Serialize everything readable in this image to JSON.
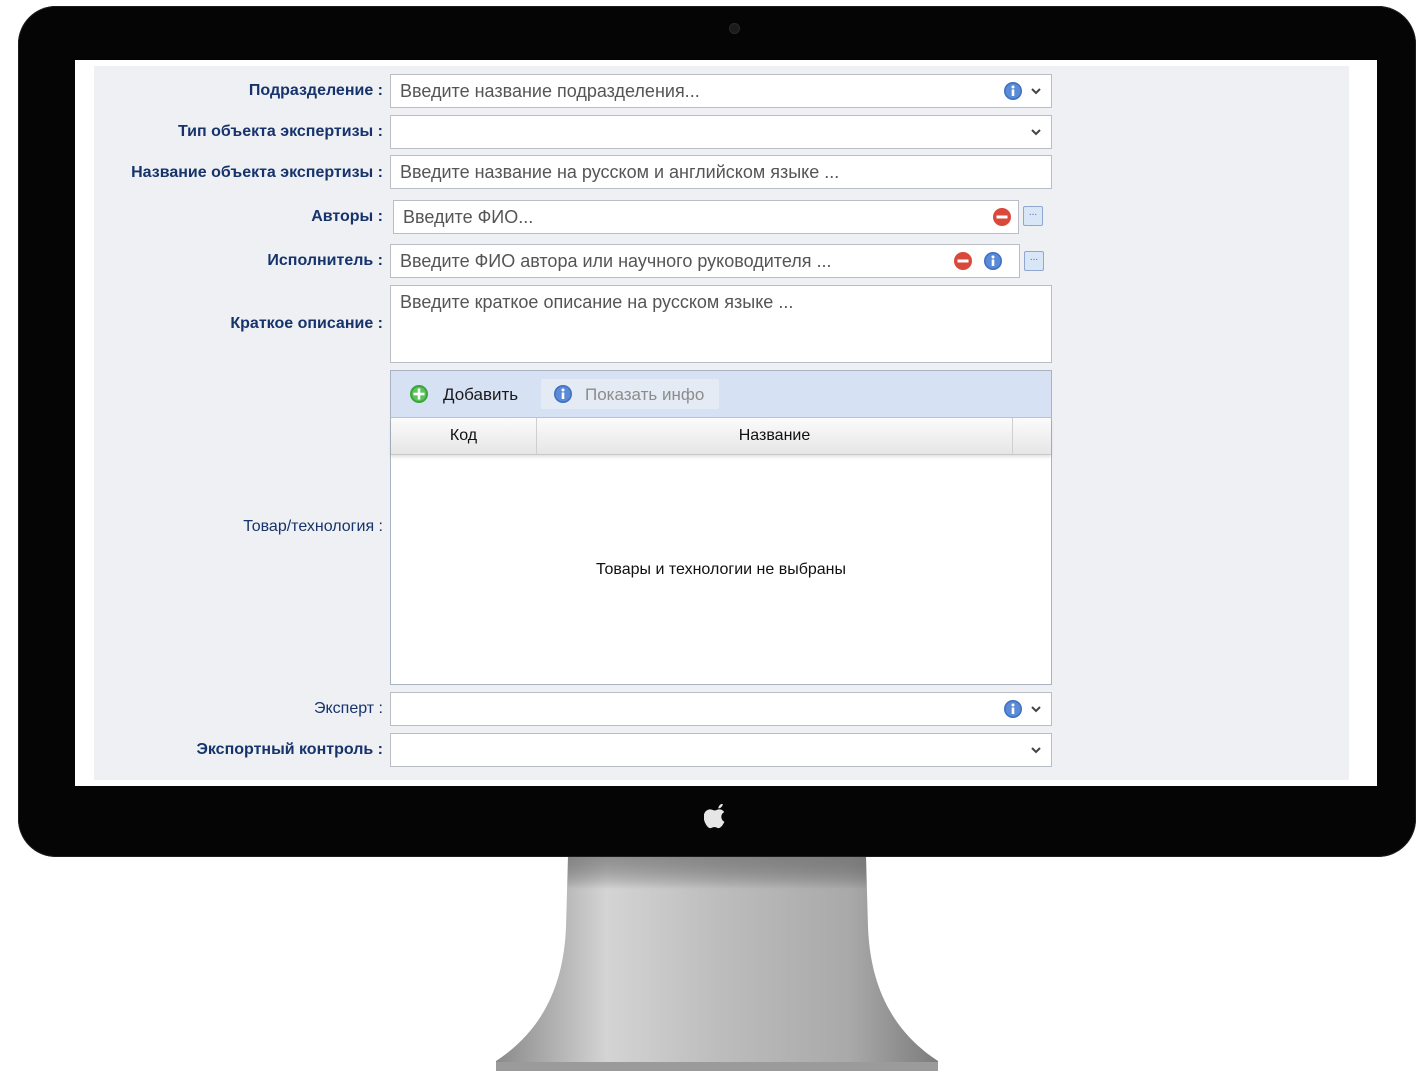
{
  "form": {
    "division": {
      "label": "Подразделение :",
      "placeholder": "Введите название подразделения..."
    },
    "object_type": {
      "label": "Тип объекта экспертизы :",
      "placeholder": ""
    },
    "object_name": {
      "label": "Название объекта экспертизы :",
      "placeholder": "Введите название на русском и английском языке ..."
    },
    "authors": {
      "label": "Авторы :",
      "placeholder": "Введите ФИО..."
    },
    "executor": {
      "label": "Исполнитель :",
      "placeholder": "Введите ФИО автора или научного руководителя ..."
    },
    "description": {
      "label": "Краткое описание :",
      "placeholder": "Введите краткое описание на русском языке ..."
    },
    "products": {
      "label": "Товар/технология :",
      "add_label": "Добавить",
      "info_label": "Показать инфо",
      "columns": [
        "Код",
        "Название"
      ],
      "empty_text": "Товары и технологии не выбраны"
    },
    "expert": {
      "label": "Эксперт :",
      "placeholder": ""
    },
    "export_control": {
      "label": "Экспортный контроль :",
      "placeholder": ""
    }
  },
  "icons": {
    "dropdown": "chevron-down-icon",
    "info": "info-icon",
    "remove": "minus-circle-icon",
    "browse": "ellipsis-icon",
    "add": "plus-circle-icon",
    "camera": "camera-icon",
    "logo": "apple-logo-icon"
  },
  "colors": {
    "label": "#17336b",
    "panel": "#eef0f3",
    "info": "#3d6fc2",
    "remove": "#d9483b",
    "add": "#3aa53a",
    "toolbar": "#d6e2f4"
  }
}
